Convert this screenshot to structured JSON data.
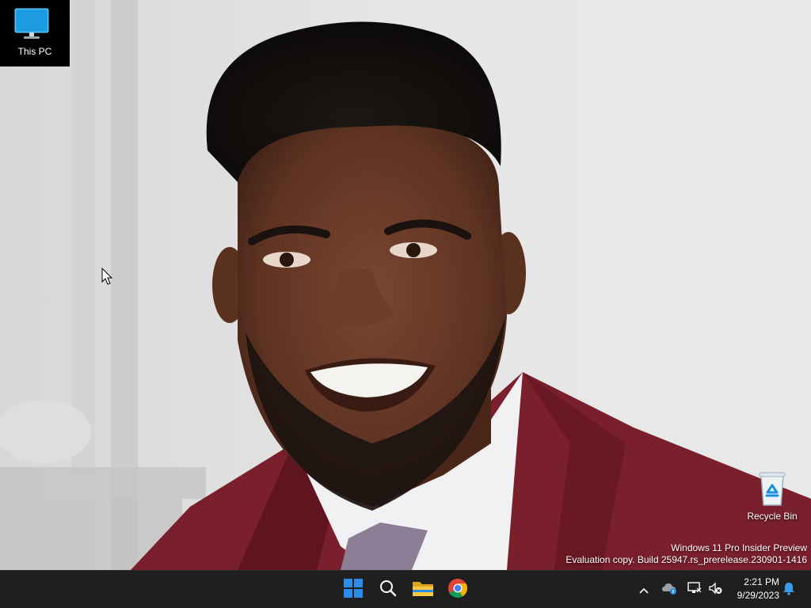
{
  "desktop": {
    "icons": [
      {
        "label": "This PC",
        "icon": "computer-monitor-icon"
      },
      {
        "label": "Recycle Bin",
        "icon": "recycle-bin-icon"
      }
    ]
  },
  "watermark": {
    "line1": "Windows 11 Pro Insider Preview",
    "line2": "Evaluation copy. Build 25947.rs_prerelease.230901-1416"
  },
  "taskbar": {
    "apps": [
      {
        "name": "Start",
        "icon": "windows-logo-icon"
      },
      {
        "name": "Search",
        "icon": "search-icon"
      },
      {
        "name": "File Explorer",
        "icon": "folder-icon"
      },
      {
        "name": "Google Chrome",
        "icon": "chrome-icon"
      }
    ],
    "tray": {
      "icons": [
        "chevron-up-icon",
        "onedrive-icon",
        "network-icon",
        "volume-muted-icon",
        "notification-bell-icon"
      ],
      "time": "2:21 PM",
      "date": "9/29/2023"
    }
  },
  "colors": {
    "taskbar": "#1f1f1f",
    "start_blue": "#2b8de8",
    "jacket": "#7a1f2c",
    "monitor_blue": "#22a8e8"
  }
}
